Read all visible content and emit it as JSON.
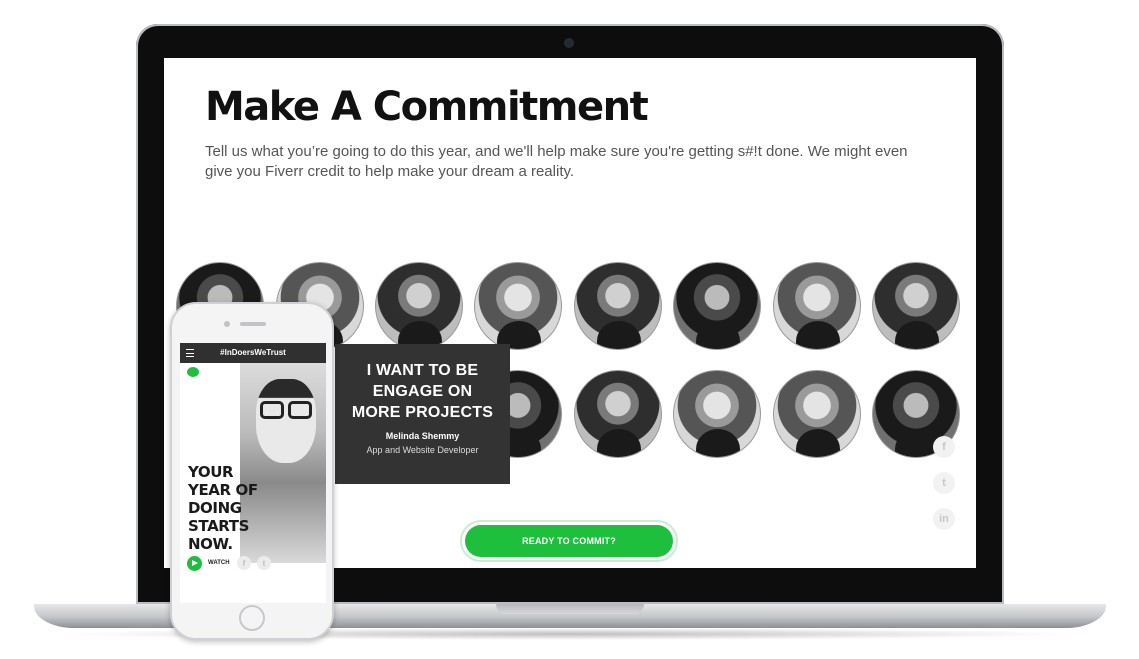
{
  "page": {
    "title": "Make A Commitment",
    "description": "Tell us what you’re going to do this year, and we'll help make sure you're getting s#!t done. We might even give you Fiverr credit to help make your dream a reality."
  },
  "quote_card": {
    "lines": [
      "I WANT TO BE",
      "ENGAGE ON",
      "MORE PROJECTS"
    ],
    "name": "Melinda Shemmy",
    "role": "App and Website Developer"
  },
  "cta": {
    "label": "READY TO COMMIT?"
  },
  "social": {
    "facebook": "f",
    "twitter": "t",
    "linkedin": "in"
  },
  "phone": {
    "nav_title": "#InDoersWeTrust",
    "hero_lines": [
      "YOUR",
      "YEAR OF",
      "DOING",
      "STARTS",
      "NOW."
    ],
    "watch_label": "WATCH",
    "mini_social": {
      "facebook": "f",
      "twitter": "t"
    }
  },
  "colors": {
    "brand_green": "#1dbf3c",
    "card_bg": "#333333",
    "text_dark": "#111111"
  },
  "icons": [
    "facebook-icon",
    "twitter-icon",
    "linkedin-icon",
    "play-icon",
    "menu-icon"
  ]
}
